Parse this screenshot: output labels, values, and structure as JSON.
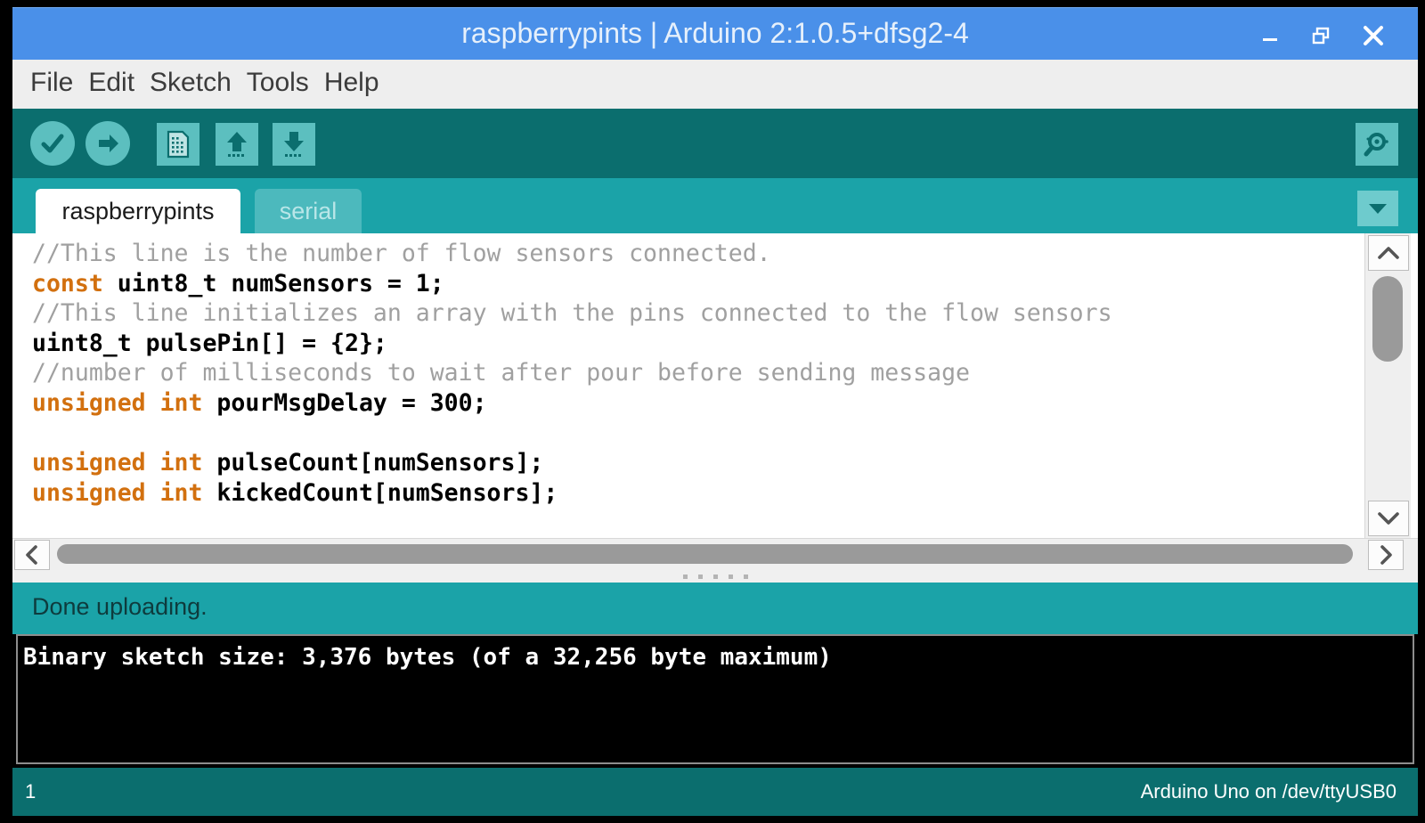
{
  "window": {
    "title": "raspberrypints | Arduino 2:1.0.5+dfsg2-4",
    "controls": {
      "minimize": "minimize-icon",
      "maximize": "restore-icon",
      "close": "close-icon"
    },
    "accent_blue": "#4a90e9",
    "accent_teal": "#1ba3a8",
    "accent_teal_dark": "#0b6e6e"
  },
  "menubar": {
    "items": [
      "File",
      "Edit",
      "Sketch",
      "Tools",
      "Help"
    ]
  },
  "toolbar": {
    "buttons": [
      {
        "name": "verify-button",
        "icon": "check-icon",
        "label": "Verify"
      },
      {
        "name": "upload-button",
        "icon": "arrow-right-icon",
        "label": "Upload"
      },
      {
        "name": "new-button",
        "icon": "new-document-icon",
        "label": "New"
      },
      {
        "name": "open-button",
        "icon": "arrow-up-icon",
        "label": "Open"
      },
      {
        "name": "save-button",
        "icon": "arrow-down-icon",
        "label": "Save"
      }
    ],
    "serial_monitor": {
      "name": "serial-monitor-button",
      "icon": "magnifier-icon",
      "label": "Serial Monitor"
    }
  },
  "tabs": {
    "items": [
      {
        "label": "raspberrypints",
        "active": true
      },
      {
        "label": "serial",
        "active": false
      }
    ],
    "menu_icon": "chevron-down-icon"
  },
  "editor": {
    "lines": [
      {
        "segments": [
          {
            "type": "comment",
            "text": "//This line is the number of flow sensors connected."
          }
        ]
      },
      {
        "segments": [
          {
            "type": "keyword",
            "text": "const"
          },
          {
            "type": "plain",
            "text": " uint8_t numSensors = 1;"
          }
        ]
      },
      {
        "segments": [
          {
            "type": "comment",
            "text": "//This line initializes an array with the pins connected to the flow sensors"
          }
        ]
      },
      {
        "segments": [
          {
            "type": "plain",
            "text": "uint8_t pulsePin[] = {2};"
          }
        ]
      },
      {
        "segments": [
          {
            "type": "comment",
            "text": "//number of milliseconds to wait after pour before sending message"
          }
        ]
      },
      {
        "segments": [
          {
            "type": "keyword",
            "text": "unsigned int"
          },
          {
            "type": "plain",
            "text": " pourMsgDelay = 300;"
          }
        ]
      },
      {
        "segments": [
          {
            "type": "plain",
            "text": ""
          }
        ]
      },
      {
        "segments": [
          {
            "type": "keyword",
            "text": "unsigned int"
          },
          {
            "type": "plain",
            "text": " pulseCount[numSensors];"
          }
        ]
      },
      {
        "segments": [
          {
            "type": "keyword",
            "text": "unsigned int"
          },
          {
            "type": "plain",
            "text": " kickedCount[numSensors];"
          }
        ]
      }
    ],
    "comment_color": "#a0a0a0",
    "keyword_color": "#d2700f",
    "text_color": "#000000"
  },
  "scrollbars": {
    "vertical": {
      "up_icon": "chevron-up-icon",
      "down_icon": "chevron-down-icon"
    },
    "horizontal": {
      "left_icon": "chevron-left-icon",
      "right_icon": "chevron-right-icon"
    }
  },
  "status": {
    "message": "Done uploading."
  },
  "console": {
    "output": "Binary sketch size: 3,376 bytes (of a 32,256 byte maximum)"
  },
  "bottombar": {
    "line_number": "1",
    "board": "Arduino Uno on /dev/ttyUSB0"
  }
}
